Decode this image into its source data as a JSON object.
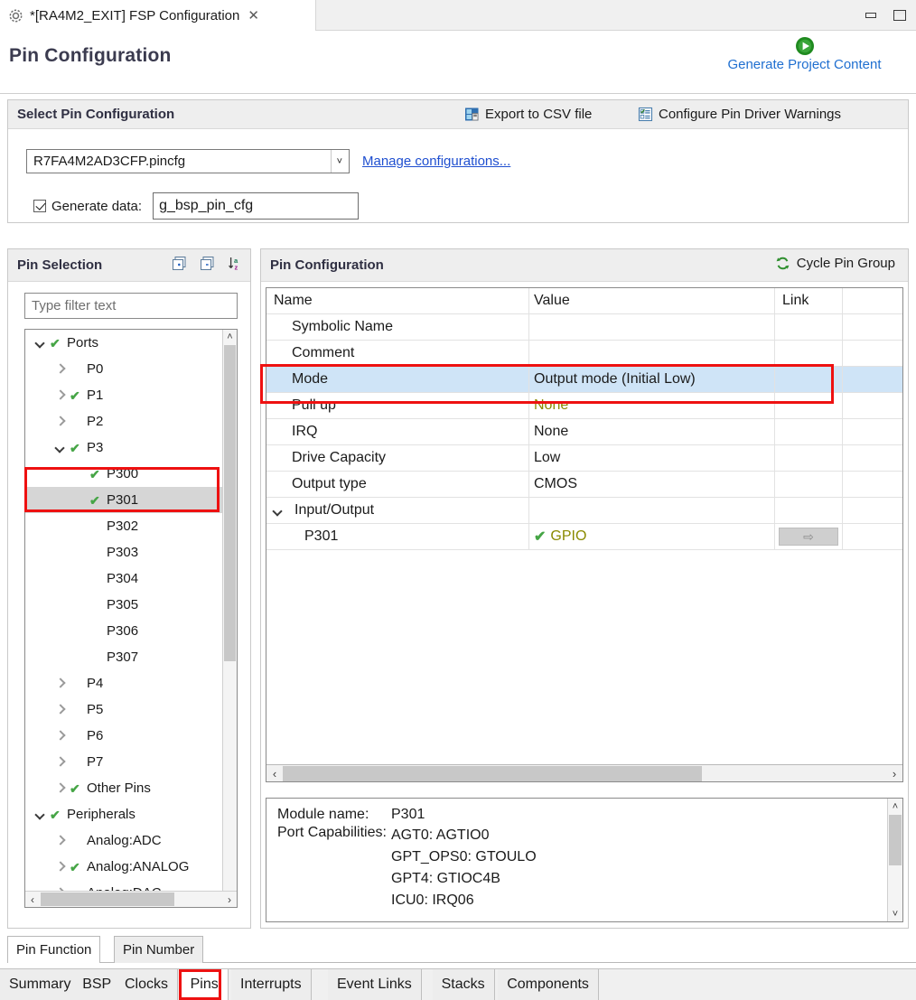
{
  "window": {
    "tab_title": "*[RA4M2_EXIT] FSP Configuration",
    "tab_close": "✕",
    "gear_icon": "gear-icon",
    "minimize_icon": "minimize-icon",
    "maximize_icon": "maximize-icon"
  },
  "header": {
    "page_title": "Pin Configuration",
    "generate_label": "Generate Project Content",
    "generate_icon": "green-play-icon"
  },
  "select_group": {
    "title": "Select Pin Configuration",
    "export_csv": "Export to CSV file",
    "export_csv_icon": "csv-save-icon",
    "configure_warnings": "Configure Pin Driver Warnings",
    "configure_warnings_icon": "checklist-icon",
    "combo_value": "R7FA4M2AD3CFP.pincfg",
    "combo_arrow": "˅",
    "manage_link": "Manage configurations...",
    "generate_data_checked": true,
    "generate_data_label": "Generate data:",
    "generate_data_value": "g_bsp_pin_cfg"
  },
  "pin_selection": {
    "title": "Pin Selection",
    "expand_all_icon": "expand-all-icon",
    "collapse_all_icon": "collapse-all-icon",
    "sort_icon": "sort-az-icon",
    "filter_placeholder": "Type filter text",
    "tree": [
      {
        "label": "Ports",
        "indent": 0,
        "twisty": "down",
        "check": true,
        "selected": false
      },
      {
        "label": "P0",
        "indent": 1,
        "twisty": "right",
        "check": false,
        "selected": false
      },
      {
        "label": "P1",
        "indent": 1,
        "twisty": "right",
        "check": true,
        "selected": false
      },
      {
        "label": "P2",
        "indent": 1,
        "twisty": "right",
        "check": false,
        "selected": false
      },
      {
        "label": "P3",
        "indent": 1,
        "twisty": "down",
        "check": true,
        "selected": false
      },
      {
        "label": "P300",
        "indent": 2,
        "twisty": "none",
        "check": true,
        "selected": false
      },
      {
        "label": "P301",
        "indent": 2,
        "twisty": "none",
        "check": true,
        "selected": true
      },
      {
        "label": "P302",
        "indent": 2,
        "twisty": "none",
        "check": false,
        "selected": false
      },
      {
        "label": "P303",
        "indent": 2,
        "twisty": "none",
        "check": false,
        "selected": false
      },
      {
        "label": "P304",
        "indent": 2,
        "twisty": "none",
        "check": false,
        "selected": false
      },
      {
        "label": "P305",
        "indent": 2,
        "twisty": "none",
        "check": false,
        "selected": false
      },
      {
        "label": "P306",
        "indent": 2,
        "twisty": "none",
        "check": false,
        "selected": false
      },
      {
        "label": "P307",
        "indent": 2,
        "twisty": "none",
        "check": false,
        "selected": false
      },
      {
        "label": "P4",
        "indent": 1,
        "twisty": "right",
        "check": false,
        "selected": false
      },
      {
        "label": "P5",
        "indent": 1,
        "twisty": "right",
        "check": false,
        "selected": false
      },
      {
        "label": "P6",
        "indent": 1,
        "twisty": "right",
        "check": false,
        "selected": false
      },
      {
        "label": "P7",
        "indent": 1,
        "twisty": "right",
        "check": false,
        "selected": false
      },
      {
        "label": "Other Pins",
        "indent": 1,
        "twisty": "right",
        "check": true,
        "selected": false
      },
      {
        "label": "Peripherals",
        "indent": 0,
        "twisty": "down",
        "check": true,
        "selected": false
      },
      {
        "label": "Analog:ADC",
        "indent": 1,
        "twisty": "right",
        "check": false,
        "selected": false
      },
      {
        "label": "Analog:ANALOG",
        "indent": 1,
        "twisty": "right",
        "check": true,
        "selected": false
      },
      {
        "label": "Analog:DAC",
        "indent": 1,
        "twisty": "right",
        "check": false,
        "selected": false
      }
    ],
    "sub_tabs": [
      {
        "label": "Pin Function",
        "active": true
      },
      {
        "label": "Pin Number",
        "active": false
      }
    ]
  },
  "pin_configuration": {
    "title": "Pin Configuration",
    "cycle_label": "Cycle Pin Group",
    "cycle_icon": "refresh-cycle-icon",
    "columns": [
      "Name",
      "Value",
      "Link"
    ],
    "rows": [
      {
        "name": "Name",
        "indent": 0,
        "value": "Value",
        "header": true,
        "twisty": "none",
        "highlighted": false,
        "value_style": "plain",
        "link": ""
      },
      {
        "name": "Symbolic Name",
        "indent": 1,
        "value": "",
        "header": false,
        "twisty": "none",
        "highlighted": false,
        "value_style": "plain",
        "link": ""
      },
      {
        "name": "Comment",
        "indent": 1,
        "value": "",
        "header": false,
        "twisty": "none",
        "highlighted": false,
        "value_style": "plain",
        "link": ""
      },
      {
        "name": "Mode",
        "indent": 1,
        "value": "Output mode (Initial Low)",
        "header": false,
        "twisty": "none",
        "highlighted": true,
        "value_style": "plain",
        "link": ""
      },
      {
        "name": "Pull up",
        "indent": 1,
        "value": "None",
        "header": false,
        "twisty": "none",
        "highlighted": false,
        "value_style": "olive",
        "link": ""
      },
      {
        "name": "IRQ",
        "indent": 1,
        "value": "None",
        "header": false,
        "twisty": "none",
        "highlighted": false,
        "value_style": "plain",
        "link": ""
      },
      {
        "name": "Drive Capacity",
        "indent": 1,
        "value": "Low",
        "header": false,
        "twisty": "none",
        "highlighted": false,
        "value_style": "plain",
        "link": ""
      },
      {
        "name": "Output type",
        "indent": 1,
        "value": "CMOS",
        "header": false,
        "twisty": "none",
        "highlighted": false,
        "value_style": "plain",
        "link": ""
      },
      {
        "name": "Input/Output",
        "indent": 0,
        "value": "",
        "header": false,
        "twisty": "down",
        "highlighted": false,
        "value_style": "plain",
        "link": ""
      },
      {
        "name": "P301",
        "indent": 2,
        "value": "GPIO",
        "header": false,
        "twisty": "none",
        "highlighted": false,
        "value_style": "olive-check",
        "link": "link-arrow-button"
      }
    ],
    "hscroll_left_icon": "‹",
    "hscroll_right_icon": "›"
  },
  "detail_panel": {
    "module_name_label": "Module name:",
    "module_name_value": "P301",
    "port_capabilities_label": "Port Capabilities:",
    "port_capabilities": [
      "AGT0: AGTIO0",
      "GPT_OPS0: GTOULO",
      "GPT4: GTIOC4B",
      "ICU0: IRQ06"
    ]
  },
  "bottom_tabs": [
    {
      "label": "Summary",
      "active": false
    },
    {
      "label": "BSP",
      "active": false
    },
    {
      "label": "Clocks",
      "active": false
    },
    {
      "label": "Pins",
      "active": true
    },
    {
      "label": "Interrupts",
      "active": false
    },
    {
      "label": "Event Links",
      "active": false
    },
    {
      "label": "Stacks",
      "active": false
    },
    {
      "label": "Components",
      "active": false
    }
  ],
  "annotations": {
    "color": "#ee1111",
    "boxes": [
      "tree-p301-highlight",
      "mode-row-highlight",
      "pins-tab-highlight"
    ]
  }
}
